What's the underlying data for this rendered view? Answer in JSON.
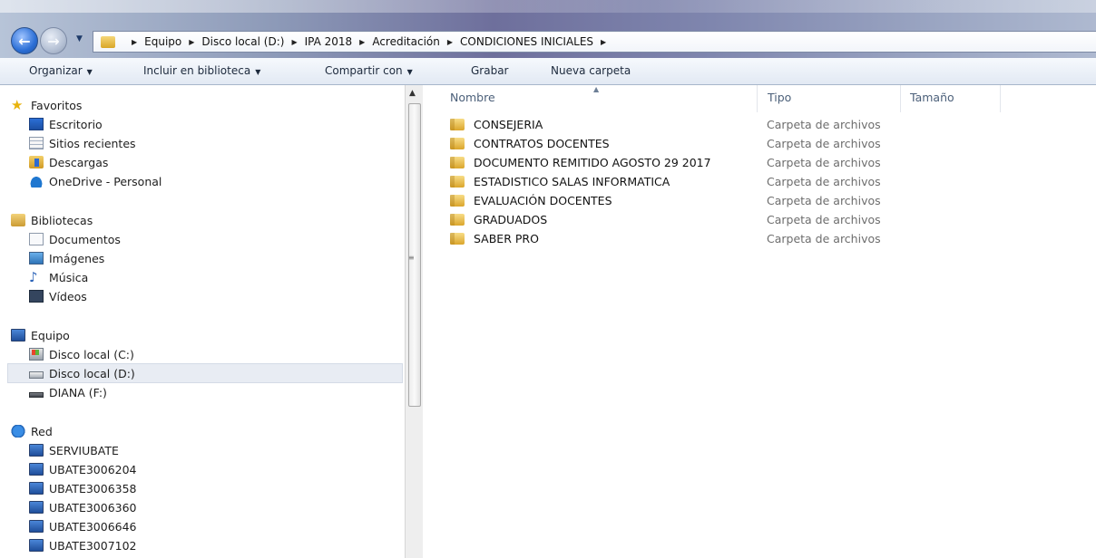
{
  "address_bar": {
    "crumbs": [
      "Equipo",
      "Disco local (D:)",
      "IPA 2018",
      "Acreditación",
      "CONDICIONES INICIALES"
    ]
  },
  "toolbar": {
    "organize": "Organizar",
    "include_library": "Incluir en biblioteca",
    "share_with": "Compartir con",
    "burn": "Grabar",
    "new_folder": "Nueva carpeta"
  },
  "nav_pane": {
    "favorites": {
      "header": "Favoritos",
      "items": [
        "Escritorio",
        "Sitios recientes",
        "Descargas",
        "OneDrive - Personal"
      ]
    },
    "libraries": {
      "header": "Bibliotecas",
      "items": [
        "Documentos",
        "Imágenes",
        "Música",
        "Vídeos"
      ]
    },
    "computer": {
      "header": "Equipo",
      "items": [
        "Disco local (C:)",
        "Disco local (D:)",
        "DIANA (F:)"
      ],
      "selected": "Disco local (D:)"
    },
    "network": {
      "header": "Red",
      "items": [
        "SERVIUBATE",
        "UBATE3006204",
        "UBATE3006358",
        "UBATE3006360",
        "UBATE3006646",
        "UBATE3007102"
      ]
    }
  },
  "file_list": {
    "columns": [
      "Nombre",
      "Tipo",
      "Tamaño"
    ],
    "rows": [
      {
        "name": "CONSEJERIA",
        "type": "Carpeta de archivos"
      },
      {
        "name": "CONTRATOS DOCENTES",
        "type": "Carpeta de archivos"
      },
      {
        "name": "DOCUMENTO REMITIDO AGOSTO 29 2017",
        "type": "Carpeta de archivos"
      },
      {
        "name": "ESTADISTICO SALAS INFORMATICA",
        "type": "Carpeta de archivos"
      },
      {
        "name": "EVALUACIÓN DOCENTES",
        "type": "Carpeta de archivos"
      },
      {
        "name": "GRADUADOS",
        "type": "Carpeta de archivos"
      },
      {
        "name": "SABER PRO",
        "type": "Carpeta de archivos"
      }
    ]
  },
  "icons": {
    "back": "back-arrow-icon",
    "forward": "forward-arrow-icon",
    "folder": "folder-icon"
  }
}
